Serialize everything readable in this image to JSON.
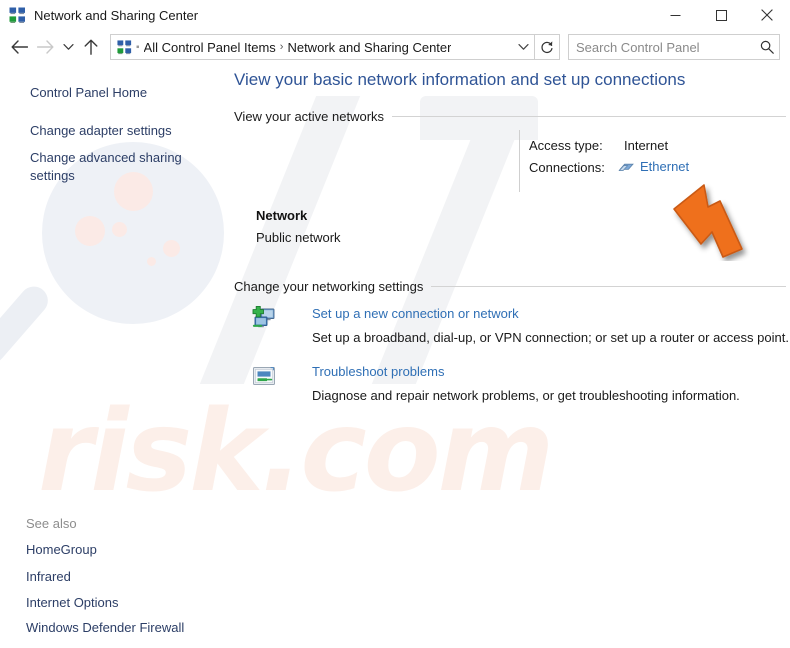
{
  "window": {
    "title": "Network and Sharing Center",
    "icon": "network-sharing-icon",
    "controls": {
      "minimize_label": "Minimize",
      "maximize_label": "Maximize",
      "close_label": "Close"
    }
  },
  "addressbar": {
    "back_label": "Back",
    "forward_label": "Forward",
    "recent_label": "Recent locations",
    "up_label": "Up",
    "breadcrumb": {
      "icon": "network-sharing-icon",
      "items": [
        "All Control Panel Items",
        "Network and Sharing Center"
      ],
      "separator": "›"
    },
    "dropdown_label": "Previous locations",
    "refresh_label": "Refresh",
    "search": {
      "placeholder": "Search Control Panel",
      "value": "",
      "icon": "search-icon"
    }
  },
  "sidebar": {
    "links": [
      "Control Panel Home",
      "Change adapter settings",
      "Change advanced sharing settings"
    ],
    "see_also": {
      "heading": "See also",
      "items": [
        "HomeGroup",
        "Infrared",
        "Internet Options",
        "Windows Defender Firewall"
      ]
    }
  },
  "main": {
    "heading": "View your basic network information and set up connections",
    "sections": {
      "active_networks": {
        "label": "View your active networks",
        "network": {
          "name": "Network",
          "type": "Public network",
          "details": [
            {
              "label": "Access type:",
              "value": "Internet"
            },
            {
              "label": "Connections:",
              "value": "Ethernet",
              "icon": "ethernet-icon",
              "is_link": true
            }
          ]
        }
      },
      "networking_settings": {
        "label": "Change your networking settings",
        "tasks": [
          {
            "icon": "new-connection-icon",
            "title": "Set up a new connection or network",
            "description": "Set up a broadband, dial-up, or VPN connection; or set up a router or access point."
          },
          {
            "icon": "troubleshoot-icon",
            "title": "Troubleshoot problems",
            "description": "Diagnose and repair network problems, or get troubleshooting information."
          }
        ]
      }
    }
  },
  "annotation": {
    "type": "arrow-cursor",
    "color": "#ef6f1f",
    "points_to": "Ethernet"
  },
  "watermark": {
    "text": "risk.com",
    "logo": "magnifier-logo"
  },
  "colors": {
    "heading_blue": "#2f5496",
    "link_blue": "#2f6fb5",
    "nav_link": "#2c3e66",
    "annotation_orange": "#ef6f1f",
    "window_bg": "#ffffff"
  }
}
